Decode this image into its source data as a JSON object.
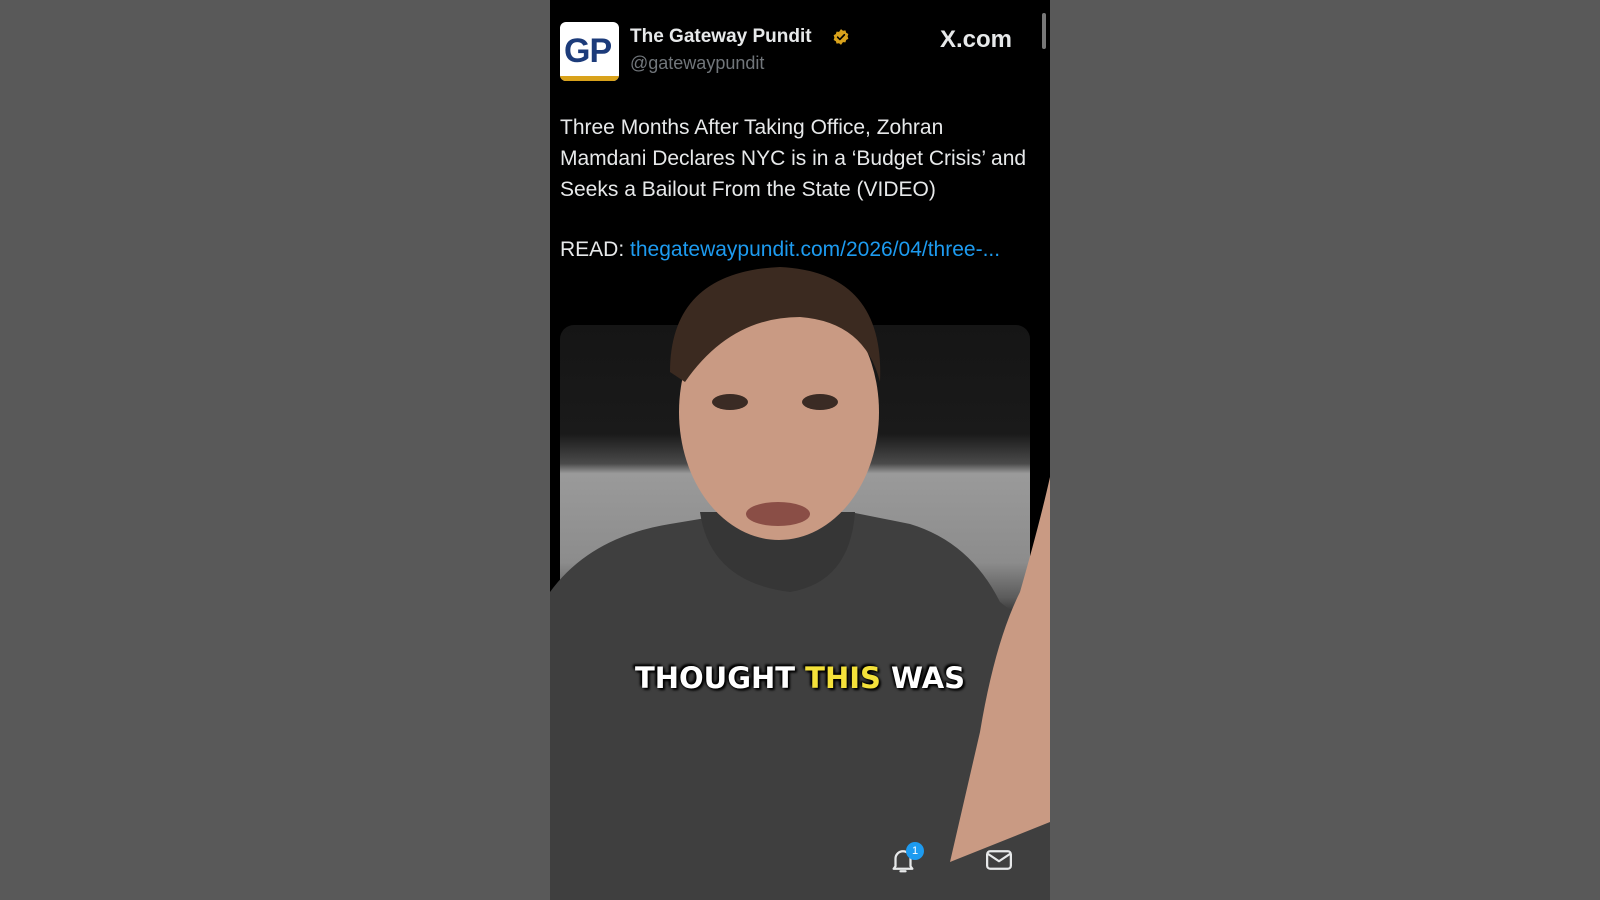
{
  "post": {
    "author_name": "The Gateway Pundit",
    "author_handle": "@gatewaypundit",
    "avatar_text": "GP",
    "site": "X.com",
    "text": "Three Months After Taking Office, Zohran Mamdani Declares NYC is in a ‘Budget Crisis’ and Seeks a Bailout From the State (VIDEO)",
    "read_label": "READ: ",
    "link_text": "thegatewaypundit.com/2026/04/three-..."
  },
  "caption": {
    "part1": "THOUGHT ",
    "highlight": "THIS",
    "part2": " WAS"
  },
  "nav": {
    "notification_count": "1"
  },
  "colors": {
    "accent": "#1d9bf0",
    "verified": "#d9a21b",
    "caption_highlight": "#f4e13a"
  }
}
